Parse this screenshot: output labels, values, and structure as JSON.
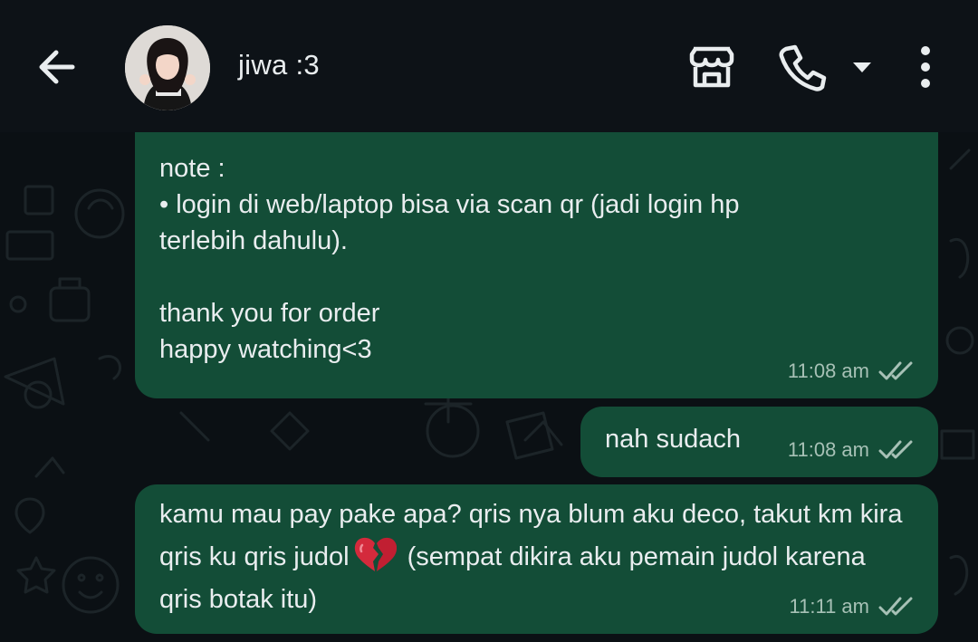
{
  "header": {
    "contact_name": "jiwa :3",
    "icons": [
      "back-arrow-icon",
      "avatar",
      "shop-icon",
      "phone-icon",
      "caret-down-icon",
      "more-vertical-icon"
    ]
  },
  "colors": {
    "header_bg": "#0d1217",
    "chat_bg": "#0b1014",
    "bubble_out": "#134d37",
    "text": "#e9edef",
    "meta_text": "#a7c1b6"
  },
  "messages": [
    {
      "text": "note :\n• login di web/laptop bisa via scan qr (jadi login hp\nterlebih dahulu).\n\nthank you for order\nhappy watching<3",
      "time": "11:08 am",
      "status": "read-ticks-icon"
    },
    {
      "text": "nah sudach",
      "time": "11:08 am",
      "status": "read-ticks-icon"
    },
    {
      "text_before": "kamu mau pay pake apa? qris nya blum aku deco, takut km kira qris ku qris judol",
      "emoji": "broken-heart-icon",
      "text_after": " (sempat dikira aku pemain judol karena qris botak itu)",
      "time": "11:11 am",
      "status": "read-ticks-icon"
    }
  ]
}
